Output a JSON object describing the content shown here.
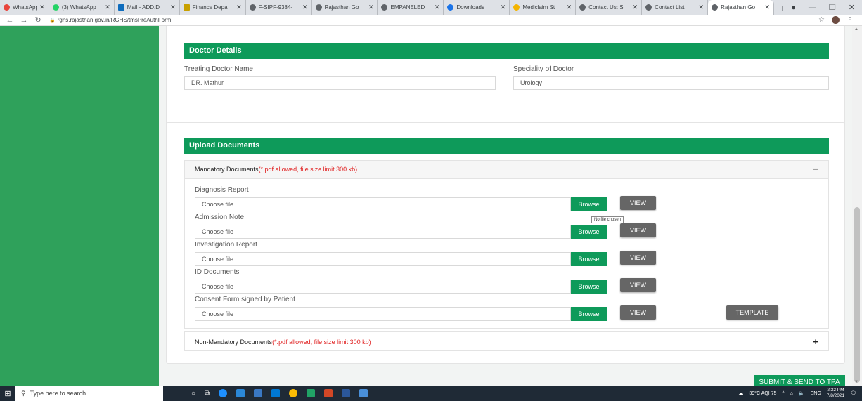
{
  "browser": {
    "tabs": [
      {
        "title": "WhatsApp",
        "color": "#e8453c"
      },
      {
        "title": "(3) WhatsApp",
        "color": "#25d366"
      },
      {
        "title": "Mail - ADD.D",
        "color": "#0f6cbd"
      },
      {
        "title": "Finance Depa",
        "color": "#c8a000"
      },
      {
        "title": "F-SIPF-9384-",
        "color": "#5f6368"
      },
      {
        "title": "Rajasthan Go",
        "color": "#5f6368"
      },
      {
        "title": "EMPANELED",
        "color": "#5f6368"
      },
      {
        "title": "Downloads",
        "color": "#1a73e8"
      },
      {
        "title": "Mediclaim St",
        "color": "#f4b400"
      },
      {
        "title": "Contact Us: S",
        "color": "#5f6368"
      },
      {
        "title": "Contact List",
        "color": "#5f6368"
      },
      {
        "title": "Rajasthan Go",
        "color": "#5f6368"
      }
    ],
    "url": "rghs.rajasthan.gov.in/RGHS/tmsPreAuthForm"
  },
  "doctor_details": {
    "heading": "Doctor Details",
    "treating_doctor_label": "Treating Doctor Name",
    "treating_doctor_value": "DR. Mathur",
    "speciality_label": "Speciality of Doctor",
    "speciality_value": "Urology"
  },
  "upload": {
    "heading": "Upload Documents",
    "mandatory_title": "Mandatory Documents",
    "mandatory_note": "(*.pdf allowed, file size limit 300 kb)",
    "mandatory_toggle": "−",
    "non_mandatory_title": "Non-Mandatory Documents",
    "non_mandatory_note": "(*.pdf allowed, file size limit 300 kb)",
    "non_mandatory_toggle": "+",
    "browse_label": "Browse",
    "view_label": "VIEW",
    "template_label": "TEMPLATE",
    "file_placeholder": "Choose file",
    "tooltip": "No file chosen",
    "documents": [
      {
        "label": "Diagnosis Report"
      },
      {
        "label": "Admission Note"
      },
      {
        "label": "Investigation Report"
      },
      {
        "label": "ID Documents"
      },
      {
        "label": "Consent Form signed by Patient"
      }
    ]
  },
  "submit_label": "SUBMIT & SEND TO TPA",
  "taskbar": {
    "search_placeholder": "Type here to search",
    "weather": "39°C  AQI 75",
    "lang": "ENG",
    "time": "2:32 PM",
    "date": "7/8/2021"
  }
}
